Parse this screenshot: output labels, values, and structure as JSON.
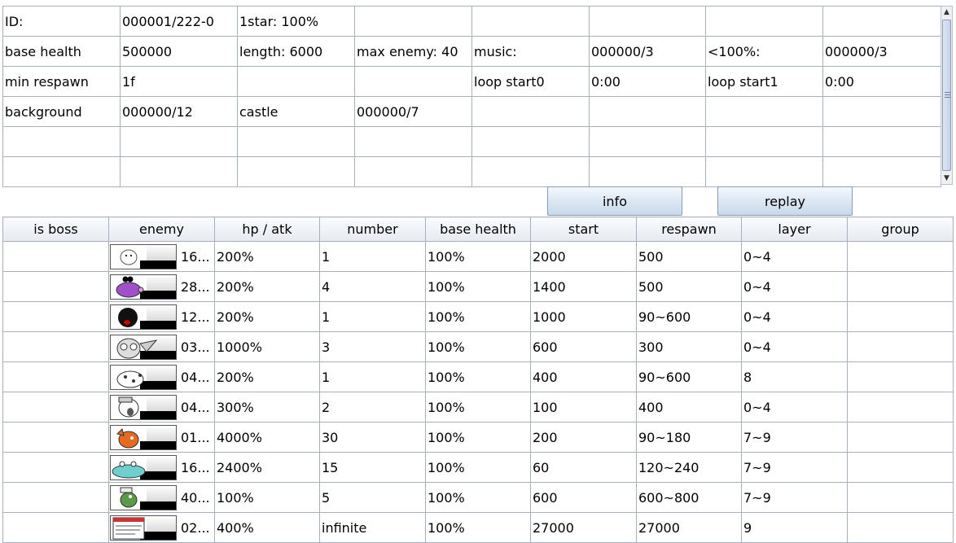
{
  "info_grid": {
    "rows": [
      [
        "ID:",
        "000001/222-0",
        "1star: 100%",
        "",
        "",
        "",
        "",
        ""
      ],
      [
        "base health",
        "500000",
        "length: 6000",
        "max enemy: 40",
        "music:",
        "000000/3",
        "<100%:",
        "000000/3"
      ],
      [
        "min respawn",
        "1f",
        "",
        "",
        "loop start0",
        "0:00",
        "loop start1",
        "0:00"
      ],
      [
        "background",
        "000000/12",
        "castle",
        "000000/7",
        "",
        "",
        "",
        ""
      ],
      [
        "",
        "",
        "",
        "",
        "",
        "",
        "",
        ""
      ],
      [
        "",
        "",
        "",
        "",
        "",
        "",
        "",
        ""
      ]
    ]
  },
  "buttons": {
    "info": "info",
    "replay": "replay"
  },
  "enemy_table": {
    "columns": [
      "is boss",
      "enemy",
      "hp / atk",
      "number",
      "base health",
      "start",
      "respawn",
      "layer",
      "group"
    ],
    "rows": [
      {
        "is_boss": "",
        "enemy": "16...",
        "icon": "white-doge-icon",
        "hp_atk": "200%",
        "number": "1",
        "base_health": "100%",
        "start": "2000",
        "respawn": "500",
        "layer": "0~4",
        "group": ""
      },
      {
        "is_boss": "",
        "enemy": "28...",
        "icon": "purple-pig-icon",
        "hp_atk": "200%",
        "number": "4",
        "base_health": "100%",
        "start": "1400",
        "respawn": "500",
        "layer": "0~4",
        "group": ""
      },
      {
        "is_boss": "",
        "enemy": "12...",
        "icon": "shadow-boxer-icon",
        "hp_atk": "200%",
        "number": "1",
        "base_health": "100%",
        "start": "1000",
        "respawn": "90~600",
        "layer": "0~4",
        "group": ""
      },
      {
        "is_boss": "",
        "enemy": "03...",
        "icon": "owl-icon",
        "hp_atk": "1000%",
        "number": "3",
        "base_health": "100%",
        "start": "600",
        "respawn": "300",
        "layer": "0~4",
        "group": ""
      },
      {
        "is_boss": "",
        "enemy": "04...",
        "icon": "spotted-beast-icon",
        "hp_atk": "200%",
        "number": "1",
        "base_health": "100%",
        "start": "400",
        "respawn": "90~600",
        "layer": "8",
        "group": ""
      },
      {
        "is_boss": "",
        "enemy": "04...",
        "icon": "screaming-creature-icon",
        "hp_atk": "300%",
        "number": "2",
        "base_health": "100%",
        "start": "100",
        "respawn": "400",
        "layer": "0~4",
        "group": ""
      },
      {
        "is_boss": "",
        "enemy": "01...",
        "icon": "orange-fish-icon",
        "hp_atk": "4000%",
        "number": "30",
        "base_health": "100%",
        "start": "200",
        "respawn": "90~180",
        "layer": "7~9",
        "group": ""
      },
      {
        "is_boss": "",
        "enemy": "16...",
        "icon": "teal-croc-icon",
        "hp_atk": "2400%",
        "number": "15",
        "base_health": "100%",
        "start": "60",
        "respawn": "120~240",
        "layer": "7~9",
        "group": ""
      },
      {
        "is_boss": "",
        "enemy": "40...",
        "icon": "green-lizard-icon",
        "hp_atk": "100%",
        "number": "5",
        "base_health": "100%",
        "start": "600",
        "respawn": "600~800",
        "layer": "7~9",
        "group": ""
      },
      {
        "is_boss": "",
        "enemy": "02...",
        "icon": "sign-board-icon",
        "hp_atk": "400%",
        "number": "infinite",
        "base_health": "100%",
        "start": "27000",
        "respawn": "27000",
        "layer": "9",
        "group": ""
      }
    ]
  }
}
